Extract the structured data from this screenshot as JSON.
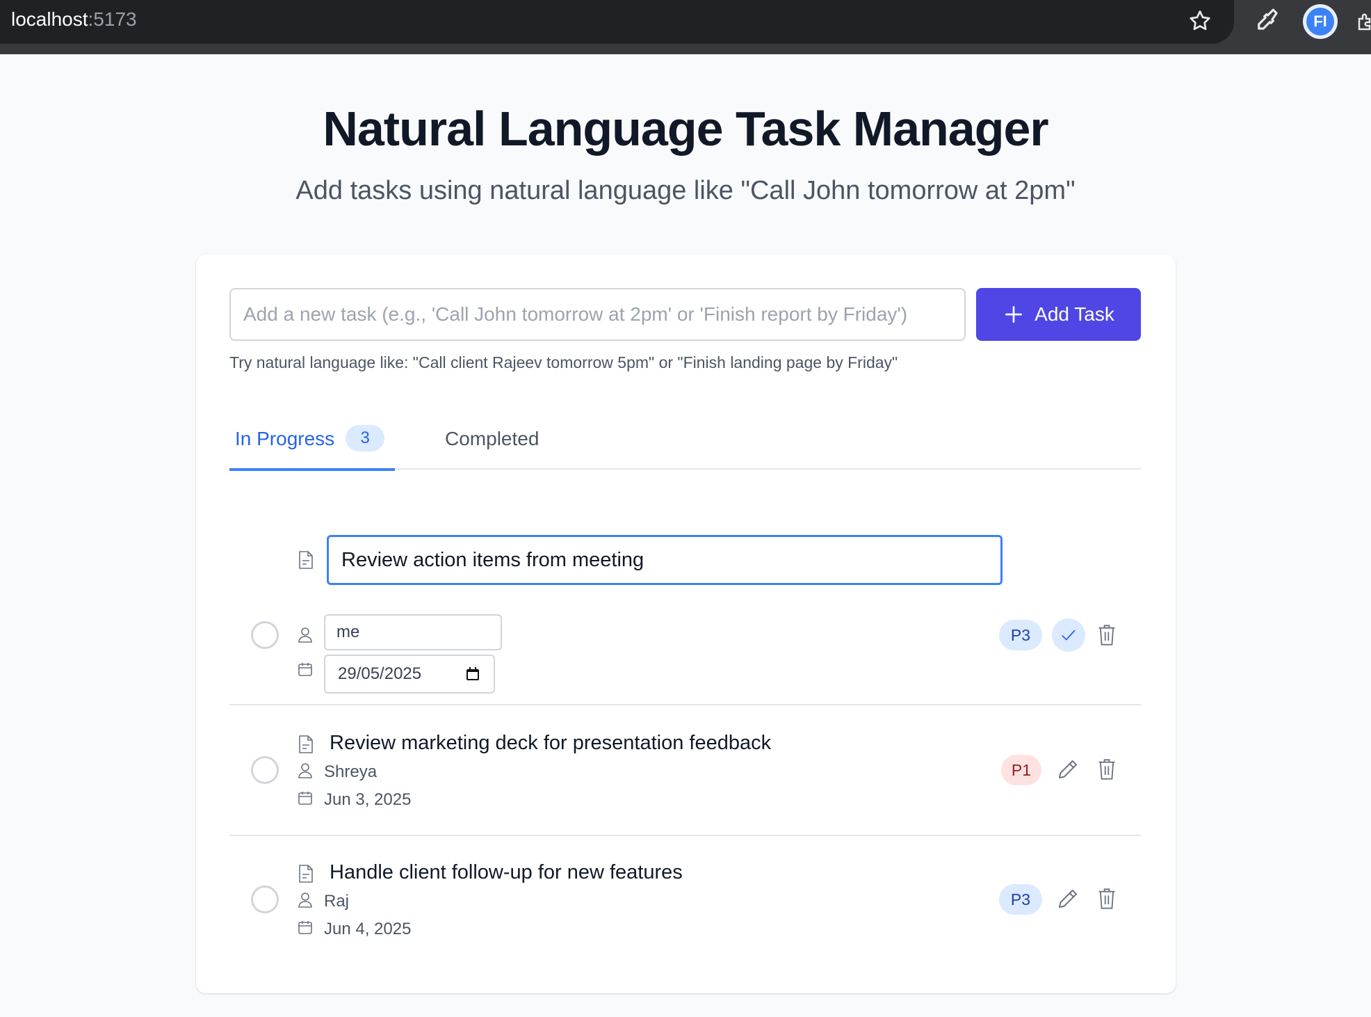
{
  "browser": {
    "url_host": "localhost",
    "url_port": ":5173",
    "extension_badge": "FI"
  },
  "header": {
    "title": "Natural Language Task Manager",
    "subtitle": "Add tasks using natural language like \"Call John tomorrow at 2pm\""
  },
  "composer": {
    "placeholder": "Add a new task (e.g., 'Call John tomorrow at 2pm' or 'Finish report by Friday')",
    "add_label": "Add Task",
    "hint": "Try natural language like: \"Call client Rajeev tomorrow 5pm\" or \"Finish landing page by Friday\""
  },
  "tabs": [
    {
      "label": "In Progress",
      "count": "3",
      "active": true
    },
    {
      "label": "Completed",
      "active": false
    }
  ],
  "editing_task": {
    "title": "Review action items from meeting",
    "assignee": "me",
    "date": "29/05/2025",
    "priority": "P3"
  },
  "tasks": [
    {
      "title": "Review marketing deck for presentation feedback",
      "assignee": "Shreya",
      "date": "Jun 3, 2025",
      "priority": "P1"
    },
    {
      "title": "Handle client follow-up for new features",
      "assignee": "Raj",
      "date": "Jun 4, 2025",
      "priority": "P3"
    }
  ],
  "colors": {
    "accent": "#4f46e5",
    "tab_active": "#2563eb",
    "p1_bg": "#fee2e2",
    "p3_bg": "#dbeafe"
  }
}
